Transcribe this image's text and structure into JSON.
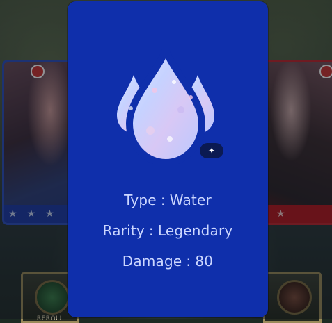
{
  "background": {
    "left_card": {
      "stars": [
        "★",
        "★",
        "★"
      ]
    },
    "right_card": {
      "stars": [
        "★"
      ]
    },
    "bottom_buttons": {
      "left_label": "REROLL",
      "right_label": ""
    }
  },
  "modal": {
    "element_icon": "water-drops-icon",
    "magic_icon": "magic-wand-icon",
    "stats": [
      {
        "label": "Type",
        "separator": ":",
        "value": "Water"
      },
      {
        "label": "Rarity",
        "separator": ":",
        "value": "Legendary"
      },
      {
        "label": "Damage",
        "separator": ":",
        "value": "80"
      }
    ]
  },
  "colors": {
    "modal_bg": "#0f2fab",
    "stat_text": "#ccd7ff",
    "left_card_border": "#2d4fbf",
    "right_card_border": "#c0262e"
  }
}
